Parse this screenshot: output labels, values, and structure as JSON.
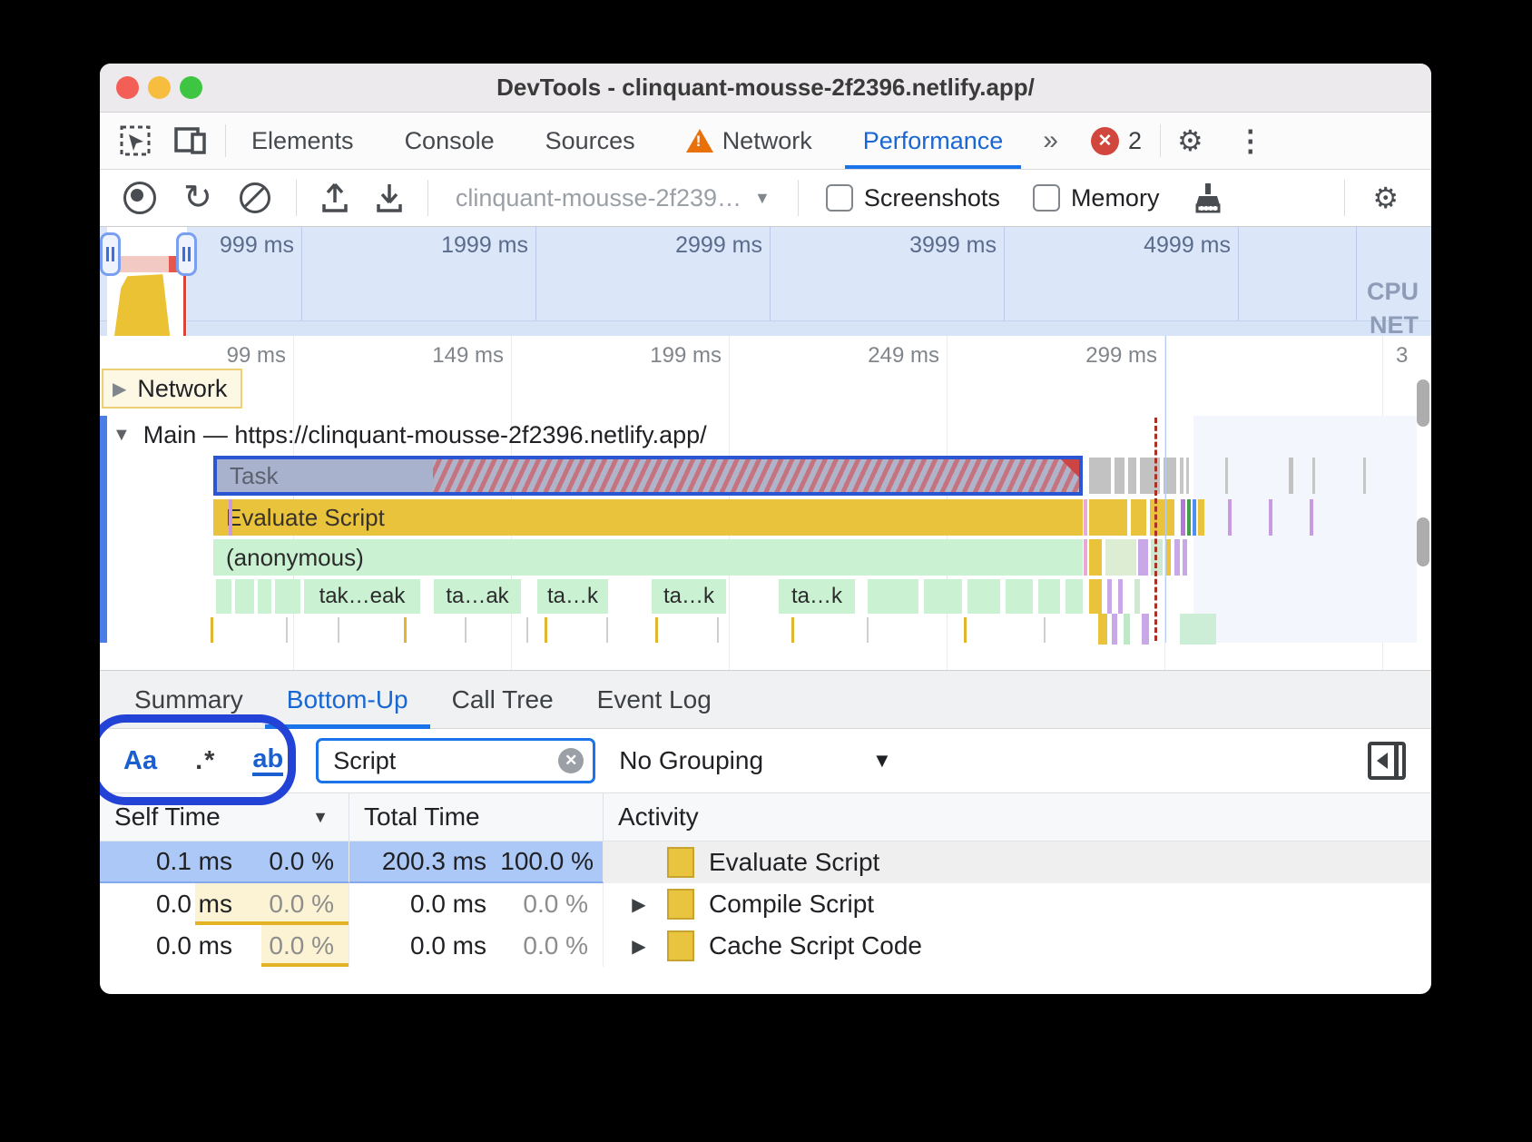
{
  "window": {
    "title": "DevTools - clinquant-mousse-2f2396.netlify.app/"
  },
  "tabbar": {
    "tabs": [
      "Elements",
      "Console",
      "Sources",
      "Network",
      "Performance"
    ],
    "more_label": "»",
    "error_count": "2"
  },
  "toolbar": {
    "profile_select": "clinquant-mousse-2f239…",
    "screenshots_label": "Screenshots",
    "memory_label": "Memory"
  },
  "overview": {
    "ticks": [
      "999 ms",
      "1999 ms",
      "2999 ms",
      "3999 ms",
      "4999 ms"
    ],
    "cpu_label": "CPU",
    "net_label": "NET"
  },
  "ruler": {
    "ticks": [
      "99 ms",
      "149 ms",
      "199 ms",
      "249 ms",
      "299 ms",
      "3"
    ]
  },
  "tracks": {
    "network_label": "Network",
    "main_label": "Main — https://clinquant-mousse-2f2396.netlify.app/",
    "task_label": "Task",
    "evaluate_label": "Evaluate Script",
    "anonymous_label": "(anonymous)",
    "chips": [
      "tak…eak",
      "ta…ak",
      "ta…k",
      "ta…k",
      "ta…k"
    ]
  },
  "bottom_tabs": {
    "items": [
      "Summary",
      "Bottom-Up",
      "Call Tree",
      "Event Log"
    ],
    "active": "Bottom-Up"
  },
  "filter": {
    "match_case": "Aa",
    "regex": ".*",
    "match_word": "ab",
    "query": "Script",
    "grouping": "No Grouping"
  },
  "table": {
    "headers": {
      "self": "Self Time",
      "total": "Total Time",
      "activity": "Activity"
    },
    "rows": [
      {
        "self": "0.1 ms",
        "self_pct": "0.0 %",
        "total": "200.3 ms",
        "total_pct": "100.0 %",
        "activity": "Evaluate Script"
      },
      {
        "self": "0.0 ms",
        "self_pct": "0.0 %",
        "total": "0.0 ms",
        "total_pct": "0.0 %",
        "activity": "Compile Script"
      },
      {
        "self": "0.0 ms",
        "self_pct": "0.0 %",
        "total": "0.0 ms",
        "total_pct": "0.0 %",
        "activity": "Cache Script Code"
      }
    ]
  },
  "colors": {
    "accent": "#1a73e8",
    "script_yellow": "#e9c43f",
    "selection_blue": "#abc8f7",
    "error_red": "#d2473d",
    "annotation_blue": "#2342d6"
  }
}
